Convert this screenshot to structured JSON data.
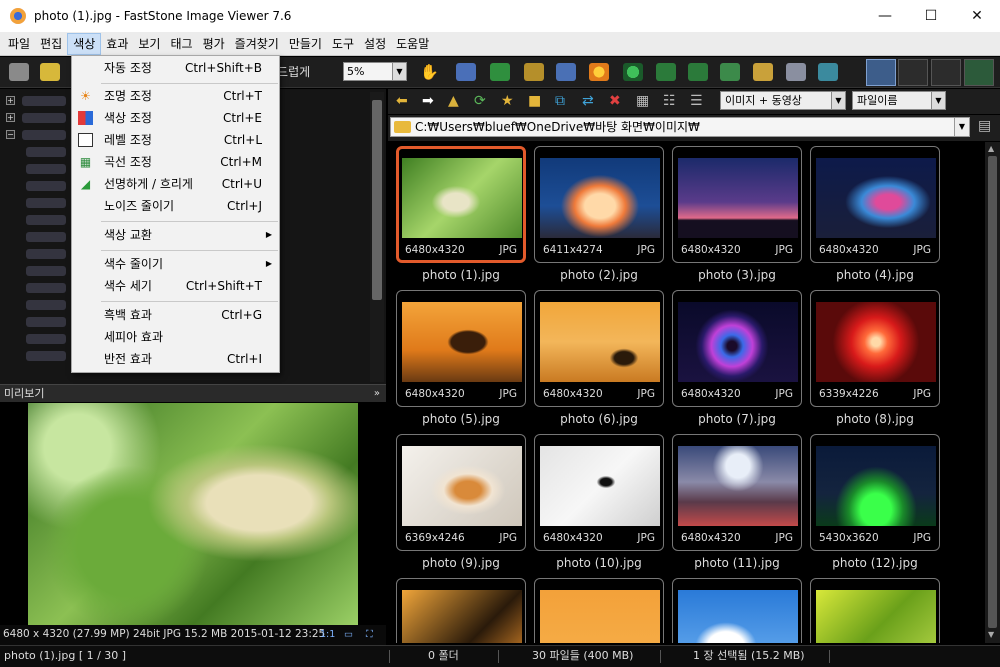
{
  "window": {
    "title": "photo (1).jpg  -  FastStone Image Viewer 7.6",
    "minimize": "—",
    "maximize": "☐",
    "close": "✕"
  },
  "menubar": [
    "파일",
    "편집",
    "색상",
    "효과",
    "보기",
    "태그",
    "평가",
    "즐겨찾기",
    "만들기",
    "도구",
    "설정",
    "도움말"
  ],
  "toolbar": {
    "smooth_label": "부드럽게",
    "zoom_value": "5%"
  },
  "color_menu": {
    "items": [
      {
        "label": "자동 조정",
        "shortcut": "Ctrl+Shift+B",
        "icon": ""
      },
      {
        "label": "조명 조정",
        "shortcut": "Ctrl+T",
        "icon": "sun-icon"
      },
      {
        "label": "색상 조정",
        "shortcut": "Ctrl+E",
        "icon": "rgb-icon"
      },
      {
        "label": "레벨 조정",
        "shortcut": "Ctrl+L",
        "icon": "levels-icon"
      },
      {
        "label": "곡선 조정",
        "shortcut": "Ctrl+M",
        "icon": "curves-icon"
      },
      {
        "label": "선명하게 / 흐리게",
        "shortcut": "Ctrl+U",
        "icon": "sharpen-icon"
      },
      {
        "label": "노이즈 줄이기",
        "shortcut": "Ctrl+J",
        "icon": ""
      },
      {
        "label": "색상 교환",
        "shortcut": "",
        "icon": "",
        "submenu": true
      },
      {
        "label": "색수 줄이기",
        "shortcut": "",
        "icon": "",
        "submenu": true
      },
      {
        "label": "색수 세기",
        "shortcut": "Ctrl+Shift+T",
        "icon": ""
      },
      {
        "label": "흑백 효과",
        "shortcut": "Ctrl+G",
        "icon": ""
      },
      {
        "label": "세피아 효과",
        "shortcut": "",
        "icon": ""
      },
      {
        "label": "반전 효과",
        "shortcut": "Ctrl+I",
        "icon": ""
      }
    ]
  },
  "preview": {
    "header": "미리보기",
    "info": "6480 x 4320 (27.99 MP)  24bit  JPG  15.2 MB  2015-01-12 23:25",
    "ratio": "1:1"
  },
  "browser": {
    "filter": "이미지 + 동영상",
    "sort": "파일이름",
    "path": "C:₩Users₩bluef₩OneDrive₩바탕 화면₩이미지₩",
    "thumbnails": [
      {
        "name": "photo (1).jpg",
        "dims": "6480x4320",
        "fmt": "JPG"
      },
      {
        "name": "photo (2).jpg",
        "dims": "6411x4274",
        "fmt": "JPG"
      },
      {
        "name": "photo (3).jpg",
        "dims": "6480x4320",
        "fmt": "JPG"
      },
      {
        "name": "photo (4).jpg",
        "dims": "6480x4320",
        "fmt": "JPG"
      },
      {
        "name": "photo (5).jpg",
        "dims": "6480x4320",
        "fmt": "JPG"
      },
      {
        "name": "photo (6).jpg",
        "dims": "6480x4320",
        "fmt": "JPG"
      },
      {
        "name": "photo (7).jpg",
        "dims": "6480x4320",
        "fmt": "JPG"
      },
      {
        "name": "photo (8).jpg",
        "dims": "6339x4226",
        "fmt": "JPG"
      },
      {
        "name": "photo (9).jpg",
        "dims": "6369x4246",
        "fmt": "JPG"
      },
      {
        "name": "photo (10).jpg",
        "dims": "6480x4320",
        "fmt": "JPG"
      },
      {
        "name": "photo (11).jpg",
        "dims": "6480x4320",
        "fmt": "JPG"
      },
      {
        "name": "photo (12).jpg",
        "dims": "5430x3620",
        "fmt": "JPG"
      }
    ]
  },
  "statusbar": {
    "file": "photo (1).jpg [ 1 / 30 ]",
    "folders": "0 폴더",
    "files": "30 파일들 (400 MB)",
    "selected": "1 장 선택됨 (15.2 MB)"
  }
}
